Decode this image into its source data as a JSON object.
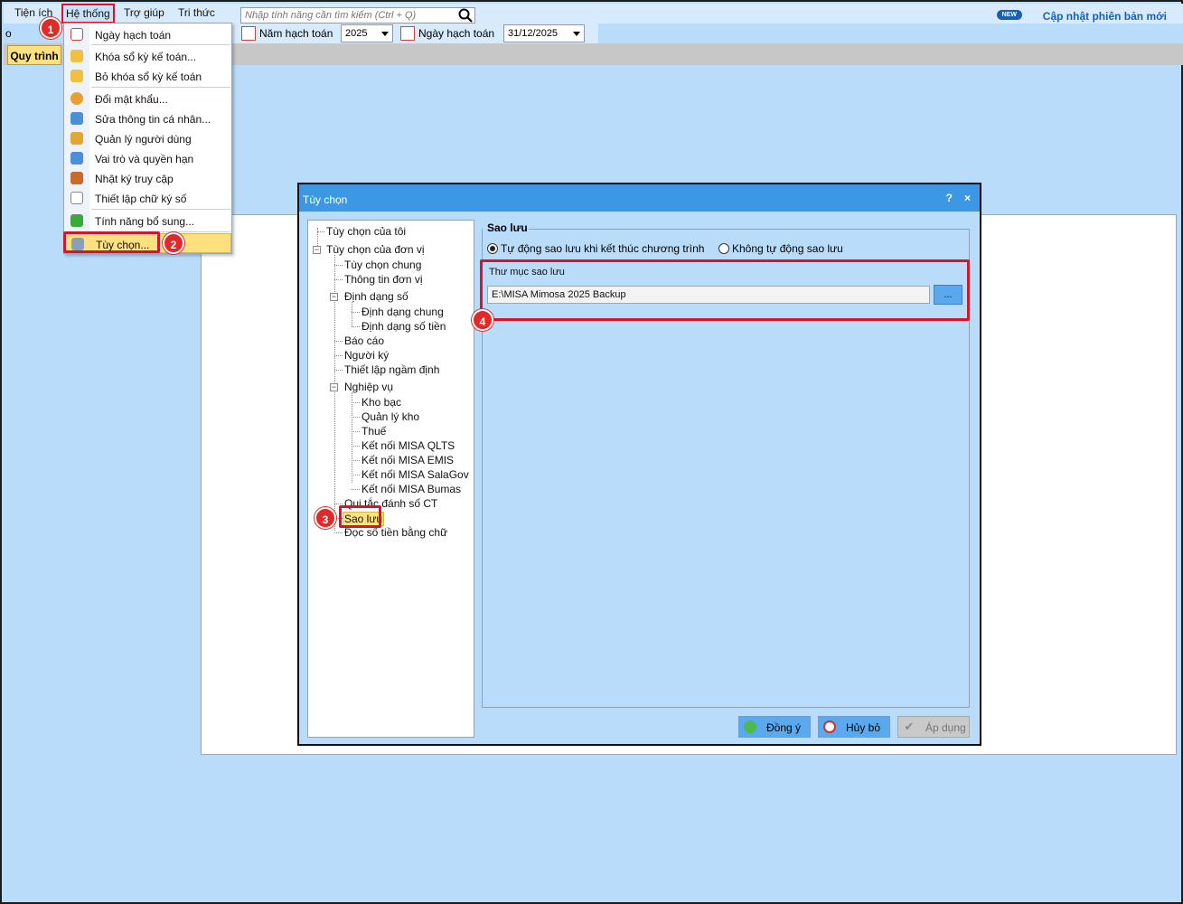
{
  "menubar": {
    "items": [
      "Tiện ích",
      "Hệ thống",
      "Trợ giúp",
      "Tri thức"
    ],
    "search_placeholder": "Nhập tính năng cần tìm kiếm (Ctrl + Q)",
    "update_label": "Cập nhật phiên bản mới",
    "new_badge": "NEW"
  },
  "toolbar": {
    "left_fragment": "o",
    "year_label": "Năm hạch toán",
    "year_value": "2025",
    "date_label": "Ngày hạch toán",
    "date_value": "31/12/2025"
  },
  "tabs": {
    "quytrinh": "Quy trình"
  },
  "dropdown": {
    "items": [
      {
        "label": "Ngày hạch toán",
        "icon": "calendar-icon"
      },
      {
        "label": "Khóa sổ kỳ kế toán...",
        "icon": "lock-icon"
      },
      {
        "label": "Bỏ khóa sổ kỳ kế toán",
        "icon": "unlock-icon"
      },
      {
        "label": "Đổi mật khẩu...",
        "icon": "key-icon"
      },
      {
        "label": "Sửa thông tin cá nhân...",
        "icon": "user-edit-icon"
      },
      {
        "label": "Quản lý người dùng",
        "icon": "users-icon"
      },
      {
        "label": "Vai trò và quyền hạn",
        "icon": "role-icon"
      },
      {
        "label": "Nhật ký truy cập",
        "icon": "log-icon"
      },
      {
        "label": "Thiết lập chữ ký số",
        "icon": "signature-icon"
      },
      {
        "label": "Tính năng bổ sung...",
        "icon": "puzzle-icon"
      },
      {
        "label": "Tùy chọn...",
        "icon": "tools-icon"
      }
    ]
  },
  "badges": [
    "1",
    "2",
    "3",
    "4"
  ],
  "dialog": {
    "title": "Tùy chọn",
    "help": "?",
    "close": "×",
    "tree": [
      "Tùy chọn của tôi",
      "Tùy chọn của đơn vị",
      "Tùy chọn chung",
      "Thông tin đơn vị",
      "Định dạng số",
      "Định dạng chung",
      "Định dạng số tiền",
      "Báo cáo",
      "Người ký",
      "Thiết lập ngầm định",
      "Nghiệp vụ",
      "Kho bạc",
      "Quản lý kho",
      "Thuế",
      "Kết nối MISA QLTS",
      "Kết nối MISA EMIS",
      "Kết nối MISA SalaGov",
      "Kết nối MISA Bumas",
      "Qui tắc đánh số CT",
      "Sao lưu",
      "Đọc số tiền bằng chữ"
    ],
    "group_title": "Sao lưu",
    "radio_auto": "Tự động sao lưu khi kết thúc chương trình",
    "radio_manual": "Không tự động sao lưu",
    "folder_label": "Thư mục sao lưu",
    "folder_value": "E:\\MISA Mimosa 2025 Backup",
    "browse": "...",
    "btn_ok": "Đồng ý",
    "btn_cancel": "Hủy bỏ",
    "btn_apply": "Áp dụng"
  }
}
